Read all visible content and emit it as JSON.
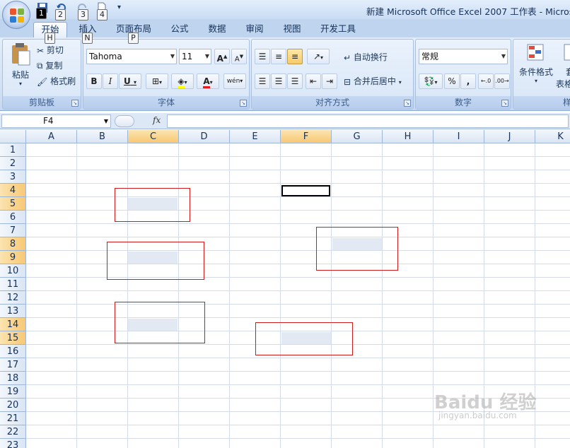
{
  "window": {
    "title": "新建 Microsoft Office Excel 2007 工作表 - Microso"
  },
  "quick_access": {
    "keytips": [
      "1",
      "2",
      "3",
      "4"
    ]
  },
  "tabs": [
    {
      "label": "开始",
      "keytip": "H",
      "active": true
    },
    {
      "label": "插入",
      "keytip": "N",
      "active": false
    },
    {
      "label": "页面布局",
      "keytip": "P",
      "active": false
    },
    {
      "label": "公式",
      "active": false
    },
    {
      "label": "数据",
      "active": false
    },
    {
      "label": "审阅",
      "active": false
    },
    {
      "label": "视图",
      "active": false
    },
    {
      "label": "开发工具",
      "active": false
    }
  ],
  "ribbon": {
    "clipboard": {
      "label": "剪贴板",
      "paste": "粘贴",
      "cut": "剪切",
      "copy": "复制",
      "format_painter": "格式刷"
    },
    "font": {
      "label": "字体",
      "font_name": "Tahoma",
      "font_size": "11",
      "bold": "B",
      "italic": "I",
      "underline": "U",
      "grow": "A",
      "shrink": "A",
      "phonetic": "wén"
    },
    "alignment": {
      "label": "对齐方式",
      "wrap_text": "自动换行",
      "merge_center": "合并后居中"
    },
    "number": {
      "label": "数字",
      "format": "常规",
      "percent": "%",
      "comma": ","
    },
    "styles": {
      "conditional_format": "条件格式",
      "table_partial": "套",
      "table_partial2": "表格",
      "label_partial": "样"
    }
  },
  "formula_bar": {
    "name_box": "F4",
    "fx": "fx",
    "content": ""
  },
  "sheet": {
    "columns": [
      "A",
      "B",
      "C",
      "D",
      "E",
      "F",
      "G",
      "H",
      "I",
      "J",
      "K"
    ],
    "selected_columns": [
      "C",
      "F"
    ],
    "rows": [
      "1",
      "2",
      "3",
      "4",
      "5",
      "6",
      "7",
      "8",
      "9",
      "10",
      "11",
      "12",
      "13",
      "14",
      "15",
      "16",
      "17",
      "18",
      "19",
      "20",
      "21",
      "22",
      "23"
    ],
    "selected_rows": [
      "4",
      "5",
      "8",
      "9",
      "14",
      "15"
    ],
    "active_cell": "F4"
  },
  "watermark": {
    "main": "Baidu 经验",
    "sub": "jingyan.baidu.com"
  },
  "colors": {
    "accent_red": "#d01b1b",
    "header_selected": "#f8c874"
  }
}
